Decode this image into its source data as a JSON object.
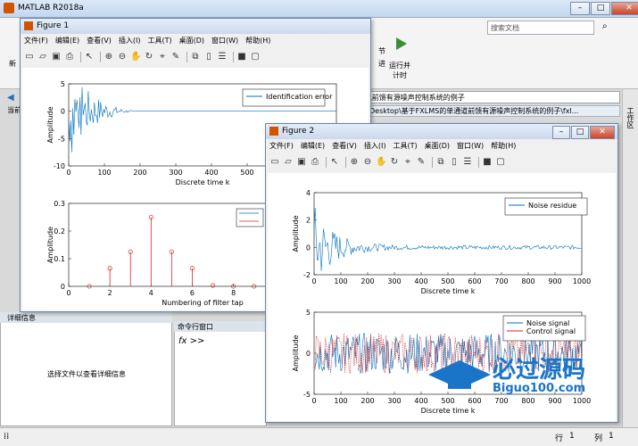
{
  "main_window": {
    "title": "MATLAB R2018a",
    "search_placeholder": "搜索文档",
    "toolstrip": {
      "new_label": "新",
      "section_label": "节",
      "advance_label": "进",
      "run_advance_label": "运行并\n计时"
    },
    "address_text": "\\前馈有源噪声控制系统的例子",
    "path_text": "Desktop\\基于FXLMS的单通道前馈有源噪声控制系统的例子\\fxl...",
    "current_folder_label": "当前",
    "workspace_label": "工作区",
    "detail_header": "详细信息",
    "detail_message": "选择文件以查看详细信息",
    "command_header": "命令行窗口",
    "prompt": "fx >>",
    "status_row_label": "行",
    "status_row": "1",
    "status_col_label": "列",
    "status_col": "1"
  },
  "menus": [
    "文件(F)",
    "编辑(E)",
    "查看(V)",
    "插入(I)",
    "工具(T)",
    "桌面(D)",
    "窗口(W)",
    "帮助(H)"
  ],
  "figure1": {
    "title": "Figure 1",
    "top_plot": {
      "ylabel": "Amplitude",
      "xlabel": "Discrete time k",
      "legend": "Identification error",
      "yticks": [
        "5",
        "0",
        "-5",
        "-10"
      ],
      "xticks": [
        "0",
        "100",
        "200",
        "300",
        "400",
        "500",
        "600",
        "700"
      ]
    },
    "bottom_plot": {
      "ylabel": "Amplitude",
      "xlabel": "Numbering of filter tap",
      "yticks": [
        "0.3",
        "0.2",
        "0.1",
        "0"
      ],
      "xticks": [
        "0",
        "2",
        "4",
        "6",
        "8",
        "10",
        "12"
      ]
    }
  },
  "figure2": {
    "title": "Figure 2",
    "top_plot": {
      "ylabel": "Amplitude",
      "xlabel": "Discrete time k",
      "legend": "Noise residue",
      "yticks": [
        "4",
        "2",
        "0",
        "-2"
      ],
      "xticks": [
        "0",
        "100",
        "200",
        "300",
        "400",
        "500",
        "600",
        "700",
        "800",
        "900",
        "1000"
      ]
    },
    "bottom_plot": {
      "ylabel": "Amplitude",
      "xlabel": "Discrete time k",
      "legend": [
        "Noise signal",
        "Control signal"
      ],
      "yticks": [
        "5",
        "0",
        "-5"
      ],
      "xticks": [
        "0",
        "100",
        "200",
        "300",
        "400",
        "500",
        "600",
        "700",
        "800",
        "900",
        "1000"
      ]
    }
  },
  "chart_data": [
    {
      "type": "line",
      "name": "fig1-top",
      "x_range": [
        0,
        750
      ],
      "ylim": [
        -10,
        5
      ],
      "series": [
        {
          "name": "Identification error",
          "shape": "decaying-oscillation",
          "initial_amplitude": 6,
          "settles_at": 200
        }
      ],
      "xlabel": "Discrete time k",
      "ylabel": "Amplitude"
    },
    {
      "type": "stem",
      "name": "fig1-bottom",
      "x": [
        1,
        2,
        3,
        4,
        5,
        6,
        7,
        8,
        9,
        10,
        11,
        12
      ],
      "values": [
        0,
        0.065,
        0.125,
        0.25,
        0.125,
        0.065,
        0.003,
        0,
        0,
        0,
        0,
        0
      ],
      "ylim": [
        0,
        0.3
      ],
      "xlim": [
        0,
        13
      ],
      "xlabel": "Numbering of filter tap",
      "ylabel": "Amplitude"
    },
    {
      "type": "line",
      "name": "fig2-top",
      "x_range": [
        0,
        1000
      ],
      "ylim": [
        -2,
        4
      ],
      "series": [
        {
          "name": "Noise residue",
          "shape": "decaying-noise",
          "initial_amplitude": 3.3,
          "steady_amplitude": 0.15
        }
      ],
      "xlabel": "Discrete time k",
      "ylabel": "Amplitude"
    },
    {
      "type": "line",
      "name": "fig2-bottom",
      "x_range": [
        0,
        1000
      ],
      "ylim": [
        -5,
        5
      ],
      "series": [
        {
          "name": "Noise signal",
          "shape": "random",
          "amplitude": 2.5
        },
        {
          "name": "Control signal",
          "shape": "random-tracking",
          "amplitude": 2.5
        }
      ],
      "xlabel": "Discrete time k",
      "ylabel": "Amplitude"
    }
  ],
  "colors": {
    "plot_blue": "#0072bd",
    "plot_red": "#d62728",
    "watermark_blue": "#1a74c8"
  },
  "watermark": {
    "text": "必过源码",
    "url": "Biguo100.com"
  }
}
